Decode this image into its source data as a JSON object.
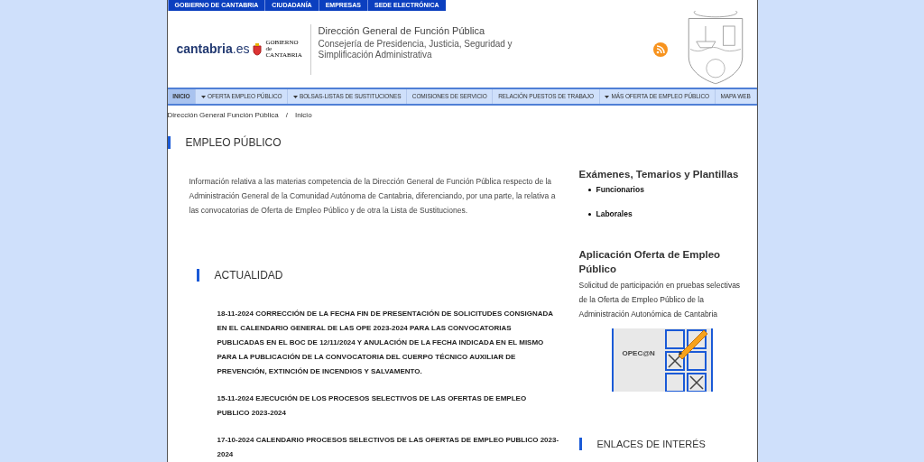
{
  "top_links": [
    "GOBIERNO DE CANTABRIA",
    "CIUDADANÍA",
    "EMPRESAS",
    "SEDE ELECTRÓNICA"
  ],
  "header": {
    "logo_text": "cantabria",
    "logo_suffix": ".es",
    "gov_logo": [
      "GOBIERNO",
      "de",
      "CANTABRIA"
    ],
    "title": "Dirección General de Función Pública",
    "subtitle": "Consejería de Presidencia, Justicia, Seguridad y Simplificación Administrativa"
  },
  "nav": [
    {
      "label": "INICIO",
      "selected": true,
      "dropdown": false
    },
    {
      "label": "OFERTA EMPLEO PÚBLICO",
      "selected": false,
      "dropdown": true
    },
    {
      "label": "BOLSAS-LISTAS DE SUSTITUCIONES",
      "selected": false,
      "dropdown": true
    },
    {
      "label": "COMISIONES DE SERVICIO",
      "selected": false,
      "dropdown": false
    },
    {
      "label": "RELACIÓN PUESTOS DE TRABAJO",
      "selected": false,
      "dropdown": false
    },
    {
      "label": "MÁS OFERTA DE EMPLEO PÚBLICO",
      "selected": false,
      "dropdown": true
    },
    {
      "label": "MAPA WEB",
      "selected": false,
      "dropdown": false
    }
  ],
  "breadcrumb": [
    "Dirección General Función Pública",
    "Inicio"
  ],
  "breadcrumb_separator": "/",
  "page_title": "EMPLEO PÚBLICO",
  "intro": "Información relativa a las materias competencia de la Dirección General de Función Pública respecto de la Administración General de la Comunidad Autónoma de Cantabria, diferenciando, por una parte, la relativa a las convocatorias de Oferta de Empleo Público y de otra la Lista de Sustituciones.",
  "news_title": "ACTUALIDAD",
  "news": [
    "18-11-2024 CORRECCIÓN DE LA FECHA FIN DE PRESENTACIÓN DE SOLICITUDES CONSIGNADA EN EL CALENDARIO GENERAL DE LAS OPE 2023-2024 PARA LAS CONVOCATORIAS PUBLICADAS EN EL BOC DE 12/11/2024 Y ANULACIÓN DE LA FECHA INDICADA EN EL MISMO PARA LA PUBLICACIÓN DE LA CONVOCATORIA DEL CUERPO TÉCNICO AUXILIAR DE PREVENCIÓN, EXTINCIÓN DE INCENDIOS Y SALVAMENTO.",
    "15-11-2024 EJECUCIÓN DE LOS PROCESOS SELECTIVOS DE LAS OFERTAS DE EMPLEO PUBLICO 2023-2024",
    "17-10-2024 CALENDARIO PROCESOS SELECTIVOS DE LAS OFERTAS DE EMPLEO PUBLICO 2023-2024"
  ],
  "sidebar": {
    "exams_title": "Exámenes, Temarios y Plantillas",
    "exams_links": [
      "Funcionarios",
      "Laborales"
    ],
    "app_title": "Aplicación Oferta de Empleo Público",
    "app_text": "Solicitud de participación en pruebas selectivas de la Oferta de Empleo Público de la Administración Autonómica de Cantabria",
    "banner_text": "OPEC@N",
    "links_title": "ENLACES DE INTERÉS"
  }
}
